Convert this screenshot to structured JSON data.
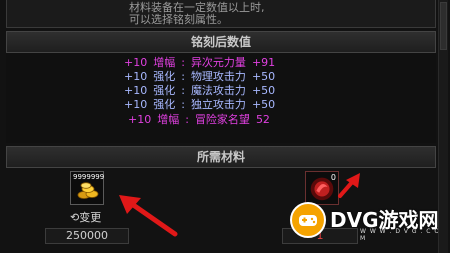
{
  "top_text": {
    "line1": "材料装备在一定数值以上时,",
    "line2": "可以选择铭刻属性。"
  },
  "section1": {
    "title": "铭刻后数值"
  },
  "stats": [
    {
      "level": "+10",
      "type": "增幅",
      "sep": ":",
      "name": "异次元力量",
      "value": "+91",
      "color": "#e040e0"
    },
    {
      "level": "+10",
      "type": "强化",
      "sep": ":",
      "name": "物理攻击力",
      "value": "+50",
      "color": "#a8b8ff"
    },
    {
      "level": "+10",
      "type": "强化",
      "sep": ":",
      "name": "魔法攻击力",
      "value": "+50",
      "color": "#a8b8ff"
    },
    {
      "level": "+10",
      "type": "强化",
      "sep": ":",
      "name": "独立攻击力",
      "value": "+50",
      "color": "#a8b8ff"
    },
    {
      "level": "+10",
      "type": "增幅",
      "sep": ":",
      "name": "冒险家名望",
      "value": "52",
      "color": "#e040e0"
    }
  ],
  "section2": {
    "title": "所需材料"
  },
  "materials": {
    "gold": {
      "stack_count": "9999999",
      "icon": "gold-coins-icon",
      "change_label": "变更",
      "amount": "250000"
    },
    "rune": {
      "count": "0",
      "icon": "red-rune-icon",
      "quantity": "1"
    }
  },
  "watermark": {
    "brand": "DVG游戏网",
    "url": "W W W . D V G . C O M"
  }
}
